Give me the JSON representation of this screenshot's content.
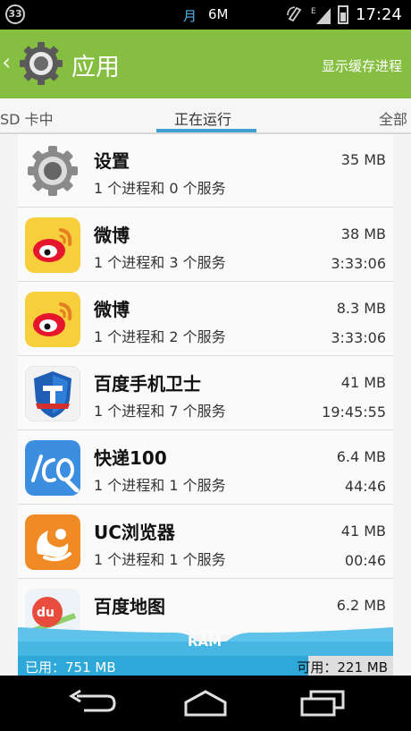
{
  "status_bar": {
    "notification_badge": "33",
    "month_icon": "月",
    "traffic": "6M",
    "time": "17:24",
    "icons": [
      "sync-icon",
      "signal-icon",
      "battery-icon"
    ]
  },
  "action_bar": {
    "title": "应用",
    "show_cached": "显示缓存进程",
    "icons": [
      "back-chevron-icon",
      "settings-gear-icon"
    ]
  },
  "tabs": [
    {
      "label": "SD 卡中"
    },
    {
      "label": "正在运行",
      "selected": true
    },
    {
      "label": "全部"
    }
  ],
  "apps": [
    {
      "name": "设置",
      "desc": "1 个进程和 0 个服务",
      "size": "35 MB",
      "time": "",
      "icon": "settings-gear-icon"
    },
    {
      "name": "微博",
      "desc": "1 个进程和 3 个服务",
      "size": "38 MB",
      "time": "3:33:06",
      "icon": "weibo-icon"
    },
    {
      "name": "微博",
      "desc": "1 个进程和 2 个服务",
      "size": "8.3 MB",
      "time": "3:33:06",
      "icon": "weibo-icon"
    },
    {
      "name": "百度手机卫士",
      "desc": "1 个进程和 7 个服务",
      "size": "41 MB",
      "time": "19:45:55",
      "icon": "baidu-guard-shield-icon"
    },
    {
      "name": "快递100",
      "desc": "1 个进程和 1 个服务",
      "size": "6.4 MB",
      "time": "44:46",
      "icon": "kuaidi100-icon"
    },
    {
      "name": "UC浏览器",
      "desc": "1 个进程和 1 个服务",
      "size": "41 MB",
      "time": "00:46",
      "icon": "uc-browser-squirrel-icon"
    },
    {
      "name": "百度地图",
      "desc": "",
      "size": "6.2 MB",
      "time": "",
      "icon": "baidu-map-du-icon"
    }
  ],
  "ram": {
    "label": "RAM",
    "used": "已用：751 MB",
    "free": "可用：221 MB",
    "used_fraction": 0.773
  },
  "colors": {
    "action_bar": "#86be42",
    "tab_indicator": "#3f9fd0",
    "ram_used": "#2ea7d9"
  },
  "nav_bar": {
    "icons": [
      "back-icon",
      "home-icon",
      "recent-apps-icon"
    ]
  }
}
